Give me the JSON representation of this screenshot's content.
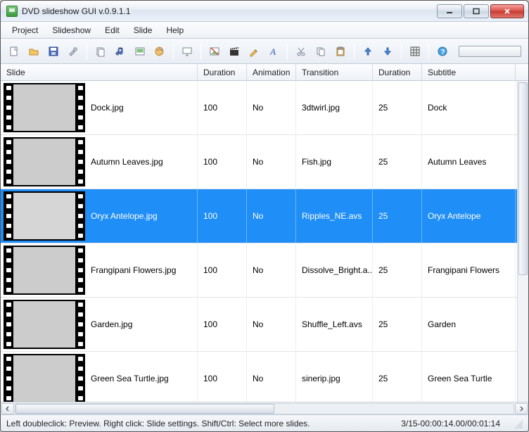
{
  "window": {
    "title": "DVD slideshow GUI v.0.9.1.1"
  },
  "menu": {
    "items": [
      "Project",
      "Slideshow",
      "Edit",
      "Slide",
      "Help"
    ]
  },
  "toolbar": {
    "icons": [
      "new-file-icon",
      "open-folder-icon",
      "save-icon",
      "tools-icon",
      "|",
      "copy-icon",
      "music-icon",
      "slide-image-icon",
      "palette-icon",
      "|",
      "presentation-icon",
      "|",
      "image-icon",
      "clapper-icon",
      "pencil-icon",
      "font-icon",
      "|",
      "cut-icon",
      "copy2-icon",
      "paste-icon",
      "|",
      "arrow-up-icon",
      "arrow-down-icon",
      "|",
      "grid-icon",
      "|",
      "help-icon"
    ]
  },
  "columns": [
    "Slide",
    "Duration",
    "Animation",
    "Transition",
    "Duration",
    "Subtitle"
  ],
  "rows": [
    {
      "thumb": "th-dock",
      "name": "Dock.jpg",
      "duration": "100",
      "animation": "No",
      "transition": "3dtwirl.jpg",
      "duration2": "25",
      "subtitle": "Dock",
      "selected": false
    },
    {
      "thumb": "th-leaves",
      "name": "Autumn Leaves.jpg",
      "duration": "100",
      "animation": "No",
      "transition": "Fish.jpg",
      "duration2": "25",
      "subtitle": "Autumn Leaves",
      "selected": false
    },
    {
      "thumb": "th-oryx",
      "name": "Oryx Antelope.jpg",
      "duration": "100",
      "animation": "No",
      "transition": "Ripples_NE.avs",
      "duration2": "25",
      "subtitle": "Oryx Antelope",
      "selected": true
    },
    {
      "thumb": "th-frang",
      "name": "Frangipani Flowers.jpg",
      "duration": "100",
      "animation": "No",
      "transition": "Dissolve_Bright.a...",
      "duration2": "25",
      "subtitle": "Frangipani Flowers",
      "selected": false
    },
    {
      "thumb": "th-garden",
      "name": "Garden.jpg",
      "duration": "100",
      "animation": "No",
      "transition": "Shuffle_Left.avs",
      "duration2": "25",
      "subtitle": "Garden",
      "selected": false
    },
    {
      "thumb": "th-turtle",
      "name": "Green Sea Turtle.jpg",
      "duration": "100",
      "animation": "No",
      "transition": "sinerip.jpg",
      "duration2": "25",
      "subtitle": "Green Sea Turtle",
      "selected": false
    }
  ],
  "status": {
    "hint": "Left doubleclick: Preview. Right click: Slide settings. Shift/Ctrl: Select more slides.",
    "position": "3/15-00:00:14.00/00:01:14"
  }
}
